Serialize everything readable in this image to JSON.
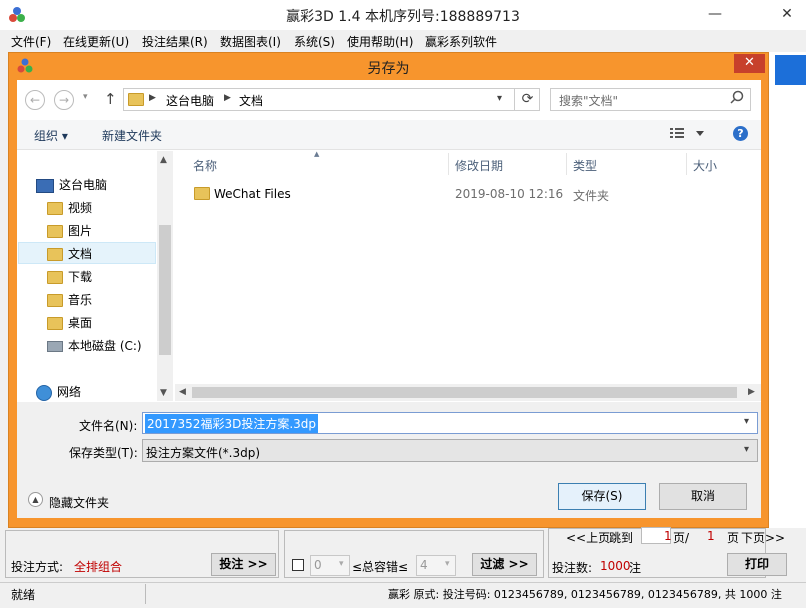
{
  "app": {
    "title": "赢彩3D 1.4  本机序列号:188889713",
    "minimize": "—",
    "close": "✕"
  },
  "menu": [
    "文件(F)",
    "在线更新(U)",
    "投注结果(R)",
    "数据图表(I)",
    "系统(S)",
    "使用帮助(H)",
    "赢彩系列软件"
  ],
  "dialog": {
    "title": "另存为",
    "close": "✕",
    "breadcrumb": [
      "这台电脑",
      "文档"
    ],
    "search_placeholder": "搜索\"文档\"",
    "organize": "组织 ▾",
    "new_folder": "新建文件夹",
    "help": "?",
    "tree": [
      {
        "label": "这台电脑",
        "icon": "computer-icon"
      },
      {
        "label": "视频",
        "icon": "folder-video-icon"
      },
      {
        "label": "图片",
        "icon": "folder-pictures-icon"
      },
      {
        "label": "文档",
        "icon": "folder-documents-icon"
      },
      {
        "label": "下载",
        "icon": "folder-downloads-icon"
      },
      {
        "label": "音乐",
        "icon": "folder-music-icon"
      },
      {
        "label": "桌面",
        "icon": "folder-desktop-icon"
      },
      {
        "label": "本地磁盘 (C:)",
        "icon": "drive-icon"
      },
      {
        "label": "网络",
        "icon": "network-icon"
      }
    ],
    "columns": {
      "name": "名称",
      "date": "修改日期",
      "type": "类型",
      "size": "大小"
    },
    "files": [
      {
        "name": "WeChat Files",
        "date": "2019-08-10 12:16",
        "type": "文件夹",
        "size": ""
      }
    ],
    "filename_label": "文件名(N):",
    "filename_value": "2017352福彩3D投注方案.3dp",
    "filetype_label": "保存类型(T):",
    "filetype_value": "投注方案文件(*.3dp)",
    "hide_folders": "隐藏文件夹",
    "save": "保存(S)",
    "cancel": "取消"
  },
  "bottom": {
    "bet_mode_label": "投注方式:",
    "bet_mode_value": "全排组合",
    "bet_button": "投注 >>",
    "combo_value_1": "0",
    "tolerance_label": "≤总容错≤",
    "combo_value_2": "4",
    "filter_button": "过滤 >>",
    "pager_prev": "<<上页",
    "pager_jump": "跳到",
    "pager_page": "1",
    "pager_sep": "页/",
    "pager_total": "1",
    "pager_unit": "页",
    "pager_next": "下页>>",
    "bet_count_label": "投注数:",
    "bet_count_value": "1000",
    "bet_count_unit": "注",
    "print_button": "打印"
  },
  "status": {
    "left": "就绪",
    "right": "赢彩  原式: 投注号码: 0123456789, 0123456789, 0123456789, 共 1000 注"
  }
}
